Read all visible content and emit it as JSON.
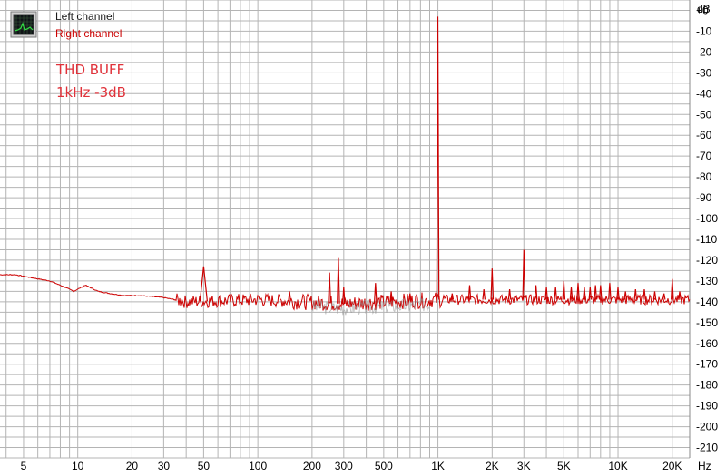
{
  "colors": {
    "left_channel": "#1a1a1a",
    "right_channel": "#cc0000",
    "annotation": "#e0323a",
    "grid": "#b4b4b4",
    "background": "#ffffff"
  },
  "legend": {
    "icon": "analyzer-window-icon",
    "left_label": "Left channel",
    "right_label": "Right channel"
  },
  "annotation": {
    "line1": "THD BUFF",
    "line2": "1kHz -3dB"
  },
  "chart_data": {
    "type": "line",
    "x_scale": "log",
    "xlim": [
      3.7,
      25000
    ],
    "ylim": [
      -215,
      5
    ],
    "grid": true,
    "legend_position": "top-left",
    "y_unit": "dB",
    "x_unit": "Hz",
    "y_ticks": [
      0,
      -10,
      -20,
      -30,
      -40,
      -50,
      -60,
      -70,
      -80,
      -90,
      -100,
      -110,
      -120,
      -130,
      -140,
      -150,
      -160,
      -170,
      -180,
      -190,
      -200,
      -210
    ],
    "y_tick_labels": [
      "+0",
      "-10",
      "-20",
      "-30",
      "-40",
      "-50",
      "-60",
      "-70",
      "-80",
      "-90",
      "-100",
      "-110",
      "-120",
      "-130",
      "-140",
      "-150",
      "-160",
      "-170",
      "-180",
      "-190",
      "-200",
      "-210"
    ],
    "x_ticks": [
      5,
      10,
      20,
      30,
      50,
      100,
      200,
      300,
      500,
      1000,
      2000,
      3000,
      5000,
      10000,
      20000
    ],
    "x_tick_labels": [
      "5",
      "10",
      "20",
      "30",
      "50",
      "100",
      "200",
      "300",
      "500",
      "1K",
      "2K",
      "3K",
      "5K",
      "10K",
      "20K"
    ],
    "series": [
      {
        "name": "Right channel",
        "baseline": [
          [
            3.7,
            -127
          ],
          [
            4.5,
            -127
          ],
          [
            6,
            -129
          ],
          [
            7,
            -130
          ],
          [
            8.5,
            -133
          ],
          [
            9.5,
            -135
          ],
          [
            11,
            -132
          ],
          [
            13,
            -135
          ],
          [
            15,
            -136
          ],
          [
            18,
            -137
          ],
          [
            22,
            -137
          ],
          [
            30,
            -138
          ],
          [
            40,
            -140
          ],
          [
            100,
            -139
          ],
          [
            300,
            -141
          ],
          [
            1000,
            -139
          ],
          [
            3000,
            -139
          ],
          [
            10000,
            -139
          ],
          [
            25000,
            -139
          ]
        ],
        "spikes": [
          [
            50,
            -123
          ],
          [
            150,
            -135
          ],
          [
            250,
            -126
          ],
          [
            280,
            -119
          ],
          [
            300,
            -133
          ],
          [
            450,
            -131
          ],
          [
            550,
            -135
          ],
          [
            700,
            -136
          ],
          [
            999,
            -3
          ],
          [
            1200,
            -136
          ],
          [
            1500,
            -132
          ],
          [
            1800,
            -134
          ],
          [
            2000,
            -124
          ],
          [
            2500,
            -134
          ],
          [
            3000,
            -115
          ],
          [
            3500,
            -132
          ],
          [
            4000,
            -133
          ],
          [
            4500,
            -133
          ],
          [
            5000,
            -130
          ],
          [
            5500,
            -133
          ],
          [
            6000,
            -131
          ],
          [
            6500,
            -133
          ],
          [
            7000,
            -133
          ],
          [
            7500,
            -132
          ],
          [
            8000,
            -132
          ],
          [
            9000,
            -131
          ],
          [
            10000,
            -133
          ],
          [
            11000,
            -135
          ],
          [
            12500,
            -134
          ],
          [
            14000,
            -134
          ],
          [
            16000,
            -135
          ],
          [
            18000,
            -136
          ],
          [
            20000,
            -129
          ],
          [
            22000,
            -135
          ]
        ]
      }
    ]
  }
}
